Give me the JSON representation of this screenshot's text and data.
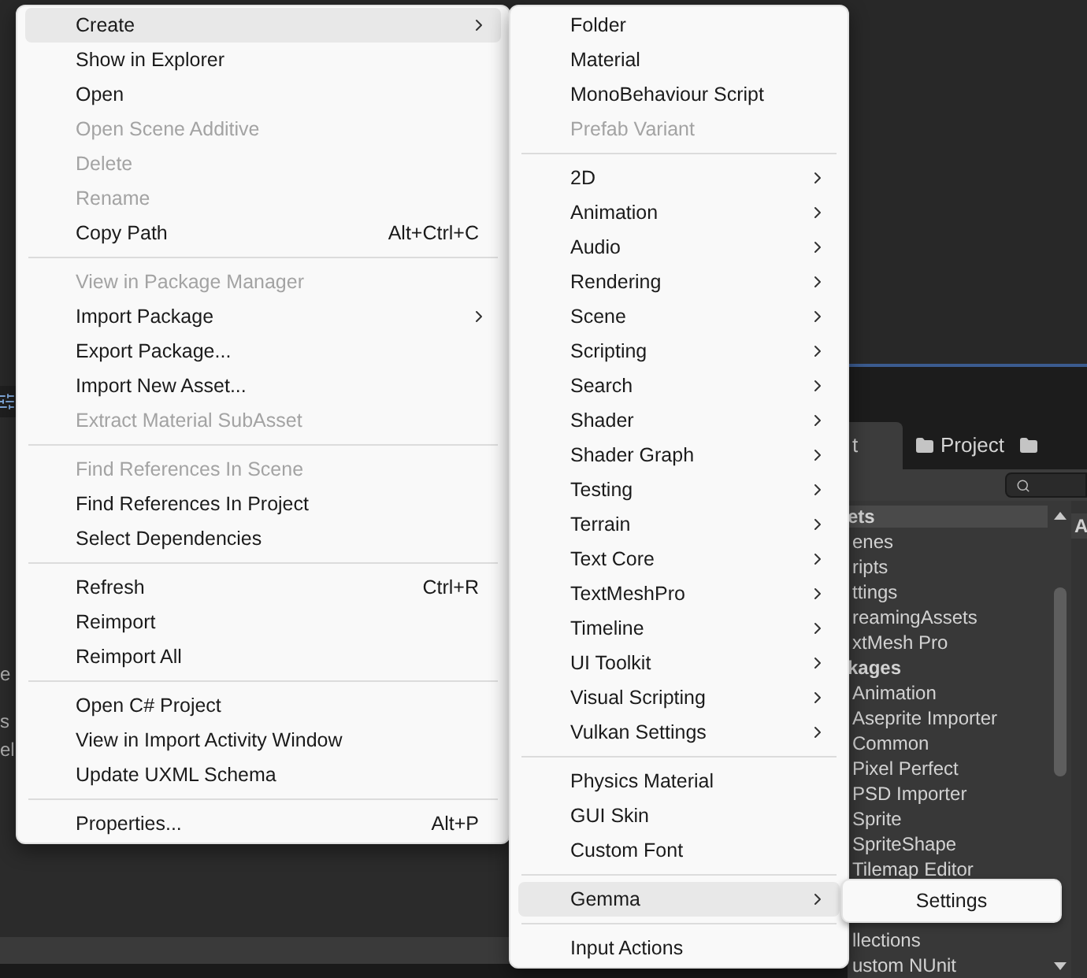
{
  "context_menu": {
    "items": [
      {
        "kind": "item",
        "label": "Create",
        "submenu": true,
        "highlighted": true,
        "disabled": false
      },
      {
        "kind": "item",
        "label": "Show in Explorer",
        "disabled": false,
        "highlighted": false
      },
      {
        "kind": "item",
        "label": "Open",
        "disabled": false,
        "highlighted": false
      },
      {
        "kind": "item",
        "label": "Open Scene Additive",
        "disabled": true,
        "highlighted": false
      },
      {
        "kind": "item",
        "label": "Delete",
        "disabled": true,
        "highlighted": false
      },
      {
        "kind": "item",
        "label": "Rename",
        "disabled": true,
        "highlighted": false
      },
      {
        "kind": "item",
        "label": "Copy Path",
        "shortcut": "Alt+Ctrl+C",
        "disabled": false,
        "highlighted": false
      },
      {
        "kind": "separator"
      },
      {
        "kind": "item",
        "label": "View in Package Manager",
        "disabled": true,
        "highlighted": false
      },
      {
        "kind": "item",
        "label": "Import Package",
        "submenu": true,
        "disabled": false,
        "highlighted": false
      },
      {
        "kind": "item",
        "label": "Export Package...",
        "disabled": false,
        "highlighted": false
      },
      {
        "kind": "item",
        "label": "Import New Asset...",
        "disabled": false,
        "highlighted": false
      },
      {
        "kind": "item",
        "label": "Extract Material SubAsset",
        "disabled": true,
        "highlighted": false
      },
      {
        "kind": "separator"
      },
      {
        "kind": "item",
        "label": "Find References In Scene",
        "disabled": true,
        "highlighted": false
      },
      {
        "kind": "item",
        "label": "Find References In Project",
        "disabled": false,
        "highlighted": false
      },
      {
        "kind": "item",
        "label": "Select Dependencies",
        "disabled": false,
        "highlighted": false
      },
      {
        "kind": "separator"
      },
      {
        "kind": "item",
        "label": "Refresh",
        "shortcut": "Ctrl+R",
        "disabled": false,
        "highlighted": false
      },
      {
        "kind": "item",
        "label": "Reimport",
        "disabled": false,
        "highlighted": false
      },
      {
        "kind": "item",
        "label": "Reimport All",
        "disabled": false,
        "highlighted": false
      },
      {
        "kind": "separator"
      },
      {
        "kind": "item",
        "label": "Open C# Project",
        "disabled": false,
        "highlighted": false
      },
      {
        "kind": "item",
        "label": "View in Import Activity Window",
        "disabled": false,
        "highlighted": false
      },
      {
        "kind": "item",
        "label": "Update UXML Schema",
        "disabled": false,
        "highlighted": false
      },
      {
        "kind": "separator"
      },
      {
        "kind": "item",
        "label": "Properties...",
        "shortcut": "Alt+P",
        "disabled": false,
        "highlighted": false
      }
    ]
  },
  "create_submenu": {
    "items": [
      {
        "kind": "item",
        "label": "Folder",
        "disabled": false,
        "highlighted": false
      },
      {
        "kind": "item",
        "label": "Material",
        "disabled": false,
        "highlighted": false
      },
      {
        "kind": "item",
        "label": "MonoBehaviour Script",
        "disabled": false,
        "highlighted": false
      },
      {
        "kind": "item",
        "label": "Prefab Variant",
        "disabled": true,
        "highlighted": false
      },
      {
        "kind": "separator"
      },
      {
        "kind": "item",
        "label": "2D",
        "submenu": true,
        "disabled": false,
        "highlighted": false
      },
      {
        "kind": "item",
        "label": "Animation",
        "submenu": true,
        "disabled": false,
        "highlighted": false
      },
      {
        "kind": "item",
        "label": "Audio",
        "submenu": true,
        "disabled": false,
        "highlighted": false
      },
      {
        "kind": "item",
        "label": "Rendering",
        "submenu": true,
        "disabled": false,
        "highlighted": false
      },
      {
        "kind": "item",
        "label": "Scene",
        "submenu": true,
        "disabled": false,
        "highlighted": false
      },
      {
        "kind": "item",
        "label": "Scripting",
        "submenu": true,
        "disabled": false,
        "highlighted": false
      },
      {
        "kind": "item",
        "label": "Search",
        "submenu": true,
        "disabled": false,
        "highlighted": false
      },
      {
        "kind": "item",
        "label": "Shader",
        "submenu": true,
        "disabled": false,
        "highlighted": false
      },
      {
        "kind": "item",
        "label": "Shader Graph",
        "submenu": true,
        "disabled": false,
        "highlighted": false
      },
      {
        "kind": "item",
        "label": "Testing",
        "submenu": true,
        "disabled": false,
        "highlighted": false
      },
      {
        "kind": "item",
        "label": "Terrain",
        "submenu": true,
        "disabled": false,
        "highlighted": false
      },
      {
        "kind": "item",
        "label": "Text Core",
        "submenu": true,
        "disabled": false,
        "highlighted": false
      },
      {
        "kind": "item",
        "label": "TextMeshPro",
        "submenu": true,
        "disabled": false,
        "highlighted": false
      },
      {
        "kind": "item",
        "label": "Timeline",
        "submenu": true,
        "disabled": false,
        "highlighted": false
      },
      {
        "kind": "item",
        "label": "UI Toolkit",
        "submenu": true,
        "disabled": false,
        "highlighted": false
      },
      {
        "kind": "item",
        "label": "Visual Scripting",
        "submenu": true,
        "disabled": false,
        "highlighted": false
      },
      {
        "kind": "item",
        "label": "Vulkan Settings",
        "submenu": true,
        "disabled": false,
        "highlighted": false
      },
      {
        "kind": "separator"
      },
      {
        "kind": "item",
        "label": "Physics Material",
        "disabled": false,
        "highlighted": false
      },
      {
        "kind": "item",
        "label": "GUI Skin",
        "disabled": false,
        "highlighted": false
      },
      {
        "kind": "item",
        "label": "Custom Font",
        "disabled": false,
        "highlighted": false
      },
      {
        "kind": "separator"
      },
      {
        "kind": "item",
        "label": "Gemma",
        "submenu": true,
        "disabled": false,
        "highlighted": true
      },
      {
        "kind": "separator"
      },
      {
        "kind": "item",
        "label": "Input Actions",
        "disabled": false,
        "highlighted": false
      }
    ]
  },
  "gemma_submenu": {
    "items": [
      {
        "label": "Settings"
      }
    ]
  },
  "background": {
    "left_fragments": [
      "e",
      "s",
      "el"
    ],
    "tabs": [
      {
        "label": "t",
        "selected": true
      },
      {
        "label": "Project",
        "selected": false
      }
    ],
    "tree_top": [
      {
        "kind": "header",
        "label": "ets",
        "selected": true
      },
      {
        "kind": "folder",
        "label": "enes",
        "selected": false
      },
      {
        "kind": "folder",
        "label": "ripts",
        "selected": false
      },
      {
        "kind": "folder",
        "label": "ttings",
        "selected": false
      },
      {
        "kind": "folder",
        "label": "reamingAssets",
        "selected": false
      },
      {
        "kind": "folder",
        "label": "xtMesh Pro",
        "selected": false
      },
      {
        "kind": "header",
        "label": "kages",
        "selected": false
      },
      {
        "kind": "folder",
        "label": "Animation",
        "selected": false
      },
      {
        "kind": "folder",
        "label": "Aseprite Importer",
        "selected": false
      },
      {
        "kind": "folder",
        "label": "Common",
        "selected": false
      },
      {
        "kind": "folder",
        "label": "Pixel Perfect",
        "selected": false
      },
      {
        "kind": "folder",
        "label": "PSD Importer",
        "selected": false
      },
      {
        "kind": "folder",
        "label": "Sprite",
        "selected": false
      },
      {
        "kind": "folder",
        "label": "SpriteShape",
        "selected": false
      },
      {
        "kind": "folder",
        "label": "Tilemap Editor",
        "selected": false
      }
    ],
    "tree_bottom": [
      {
        "kind": "folder",
        "label": "llections",
        "selected": false
      },
      {
        "kind": "folder",
        "label": "ustom NUnit",
        "selected": false
      }
    ],
    "right_pane_header": "A"
  }
}
